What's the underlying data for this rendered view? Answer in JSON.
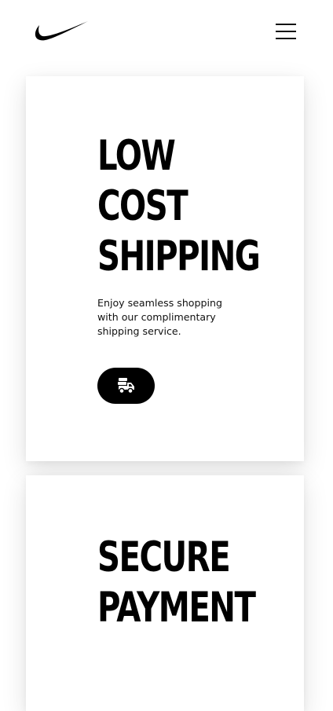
{
  "header": {
    "logo_icon": "swoosh-logo-icon",
    "menu_icon": "hamburger-menu-icon"
  },
  "cards": [
    {
      "title_lines": [
        "LOW",
        "COST",
        "SHIPPING"
      ],
      "description": "Enjoy seamless shopping with our complimentary shipping service.",
      "button_icon": "delivery-truck-icon"
    },
    {
      "title_lines": [
        "SECURE",
        "PAYMENT"
      ]
    }
  ],
  "colors": {
    "background": "#ffffff",
    "text": "#000000",
    "button": "#000000"
  }
}
